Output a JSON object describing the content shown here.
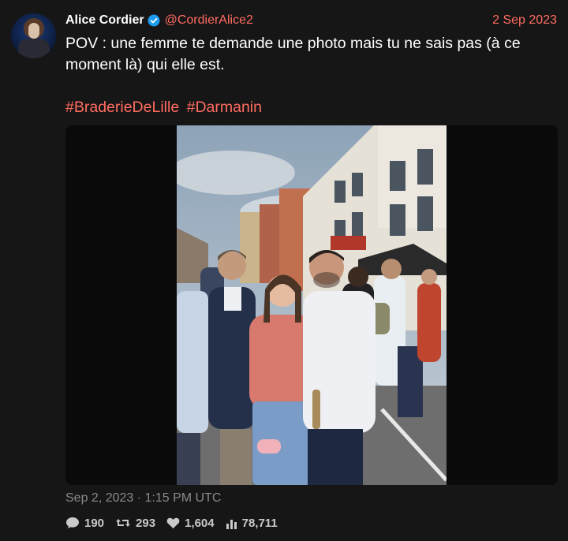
{
  "tweet": {
    "display_name": "Alice Cordier",
    "verified_icon": "verified-badge-icon",
    "handle": "@CordierAlice2",
    "date": "2 Sep 2023",
    "text": "POV : une femme te demande une photo mais tu ne sais pas (à ce moment là) qui elle est.",
    "hashtags": [
      "#BraderieDeLille",
      "#Darmanin"
    ],
    "timestamp": "Sep 2, 2023 · 1:15 PM UTC",
    "stats": {
      "replies": "190",
      "retweets": "293",
      "likes": "1,604",
      "views": "78,711"
    }
  },
  "colors": {
    "background": "#161616",
    "accent": "#ff6c60",
    "verified": "#1d9bf0",
    "muted": "#8a8a8a"
  },
  "icons": {
    "reply": "comment-icon",
    "retweet": "retweet-icon",
    "like": "heart-icon",
    "views": "bar-chart-icon"
  }
}
